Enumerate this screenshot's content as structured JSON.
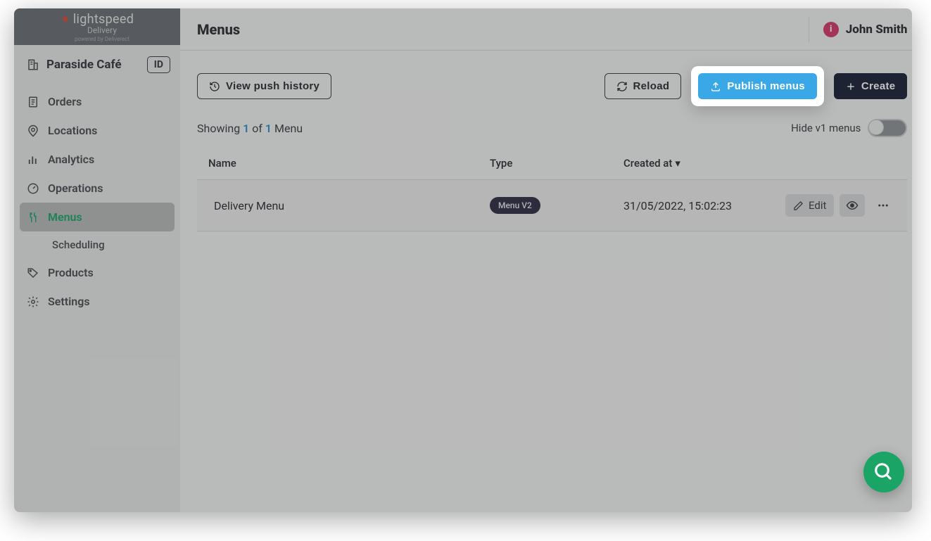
{
  "brand": {
    "name": "lightspeed",
    "sub": "Delivery",
    "powered": "powered by Deliverect"
  },
  "org": {
    "name": "Paraside Café",
    "id_badge": "ID"
  },
  "sidebar": {
    "items": [
      {
        "label": "Orders"
      },
      {
        "label": "Locations"
      },
      {
        "label": "Analytics"
      },
      {
        "label": "Operations"
      },
      {
        "label": "Menus"
      },
      {
        "label": "Products"
      },
      {
        "label": "Settings"
      }
    ],
    "sub": {
      "scheduling": "Scheduling"
    }
  },
  "header": {
    "title": "Menus"
  },
  "user": {
    "name": "John Smith",
    "initial": "i"
  },
  "toolbar": {
    "view_push_history": "View push history",
    "reload": "Reload",
    "publish_menus": "Publish menus",
    "create": "Create"
  },
  "subbar": {
    "showing_prefix": "Showing ",
    "showing_current": "1",
    "showing_of": " of ",
    "showing_total": "1",
    "showing_suffix": " Menu",
    "hide_v1": "Hide v1 menus"
  },
  "table": {
    "headers": {
      "name": "Name",
      "type": "Type",
      "created": "Created at"
    },
    "rows": [
      {
        "name": "Delivery Menu",
        "type_pill": "Menu V2",
        "created": "31/05/2022, 15:02:23",
        "edit": "Edit"
      }
    ]
  }
}
